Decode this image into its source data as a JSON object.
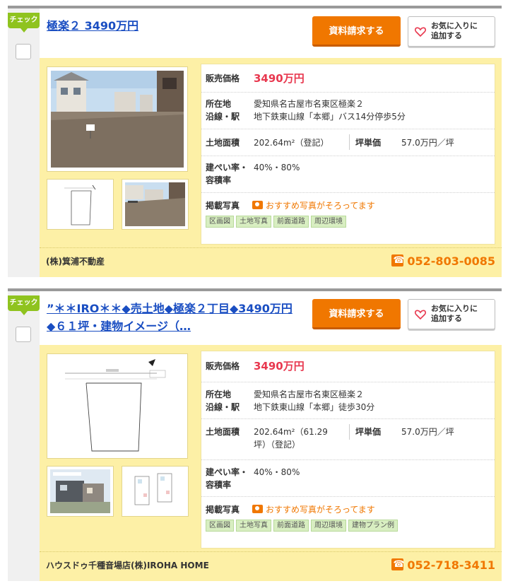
{
  "check_label": "チェック",
  "listings": [
    {
      "title": "極楽２ 3490万円",
      "request_button": "資料請求する",
      "favorite_button": [
        "お気に入りに",
        "追加する"
      ],
      "labels": {
        "price": "販売価格",
        "location": "所在地",
        "line_station": "沿線・駅",
        "land_area": "土地面積",
        "tsubo_price": "坪単価",
        "coverage": "建ぺい率・",
        "floor_ratio": "容積率",
        "photos": "掲載写真"
      },
      "price": "3490万円",
      "address": "愛知県名古屋市名東区極楽２",
      "access": "地下鉄東山線「本郷」バス14分停歩5分",
      "land_area_lines": [
        "202.64m²（登記）"
      ],
      "tsubo_price": "57.0万円／坪",
      "ratio": "40%・80%",
      "recommend_text": "おすすめ写真がそろってます",
      "tags": [
        "区画図",
        "土地写真",
        "前面道路",
        "周辺環境"
      ],
      "company": "(株)箕浦不動産",
      "phone": "052-803-0085"
    },
    {
      "title": "”＊＊IRO＊＊◆売土地◆極楽２丁目◆3490万円◆６１坪・建物イメージ（…",
      "request_button": "資料請求する",
      "favorite_button": [
        "お気に入りに",
        "追加する"
      ],
      "labels": {
        "price": "販売価格",
        "location": "所在地",
        "line_station": "沿線・駅",
        "land_area": "土地面積",
        "tsubo_price": "坪単価",
        "coverage": "建ぺい率・",
        "floor_ratio": "容積率",
        "photos": "掲載写真"
      },
      "price": "3490万円",
      "address": "愛知県名古屋市名東区極楽２",
      "access": "地下鉄東山線「本郷」徒歩30分",
      "land_area_lines": [
        "202.64m²（61.29",
        "坪）（登記）"
      ],
      "tsubo_price": "57.0万円／坪",
      "ratio": "40%・80%",
      "recommend_text": "おすすめ写真がそろってます",
      "tags": [
        "区画図",
        "土地写真",
        "前面道路",
        "周辺環境",
        "建物プラン例"
      ],
      "company": "ハウスドゥ千種音場店(株)IROHA HOME",
      "phone": "052-718-3411"
    }
  ],
  "colors": {
    "accent": "#f07700",
    "price": "#e8384f",
    "panel": "#fdf0a6",
    "link": "#1a4ec2",
    "check": "#8fc31f"
  }
}
